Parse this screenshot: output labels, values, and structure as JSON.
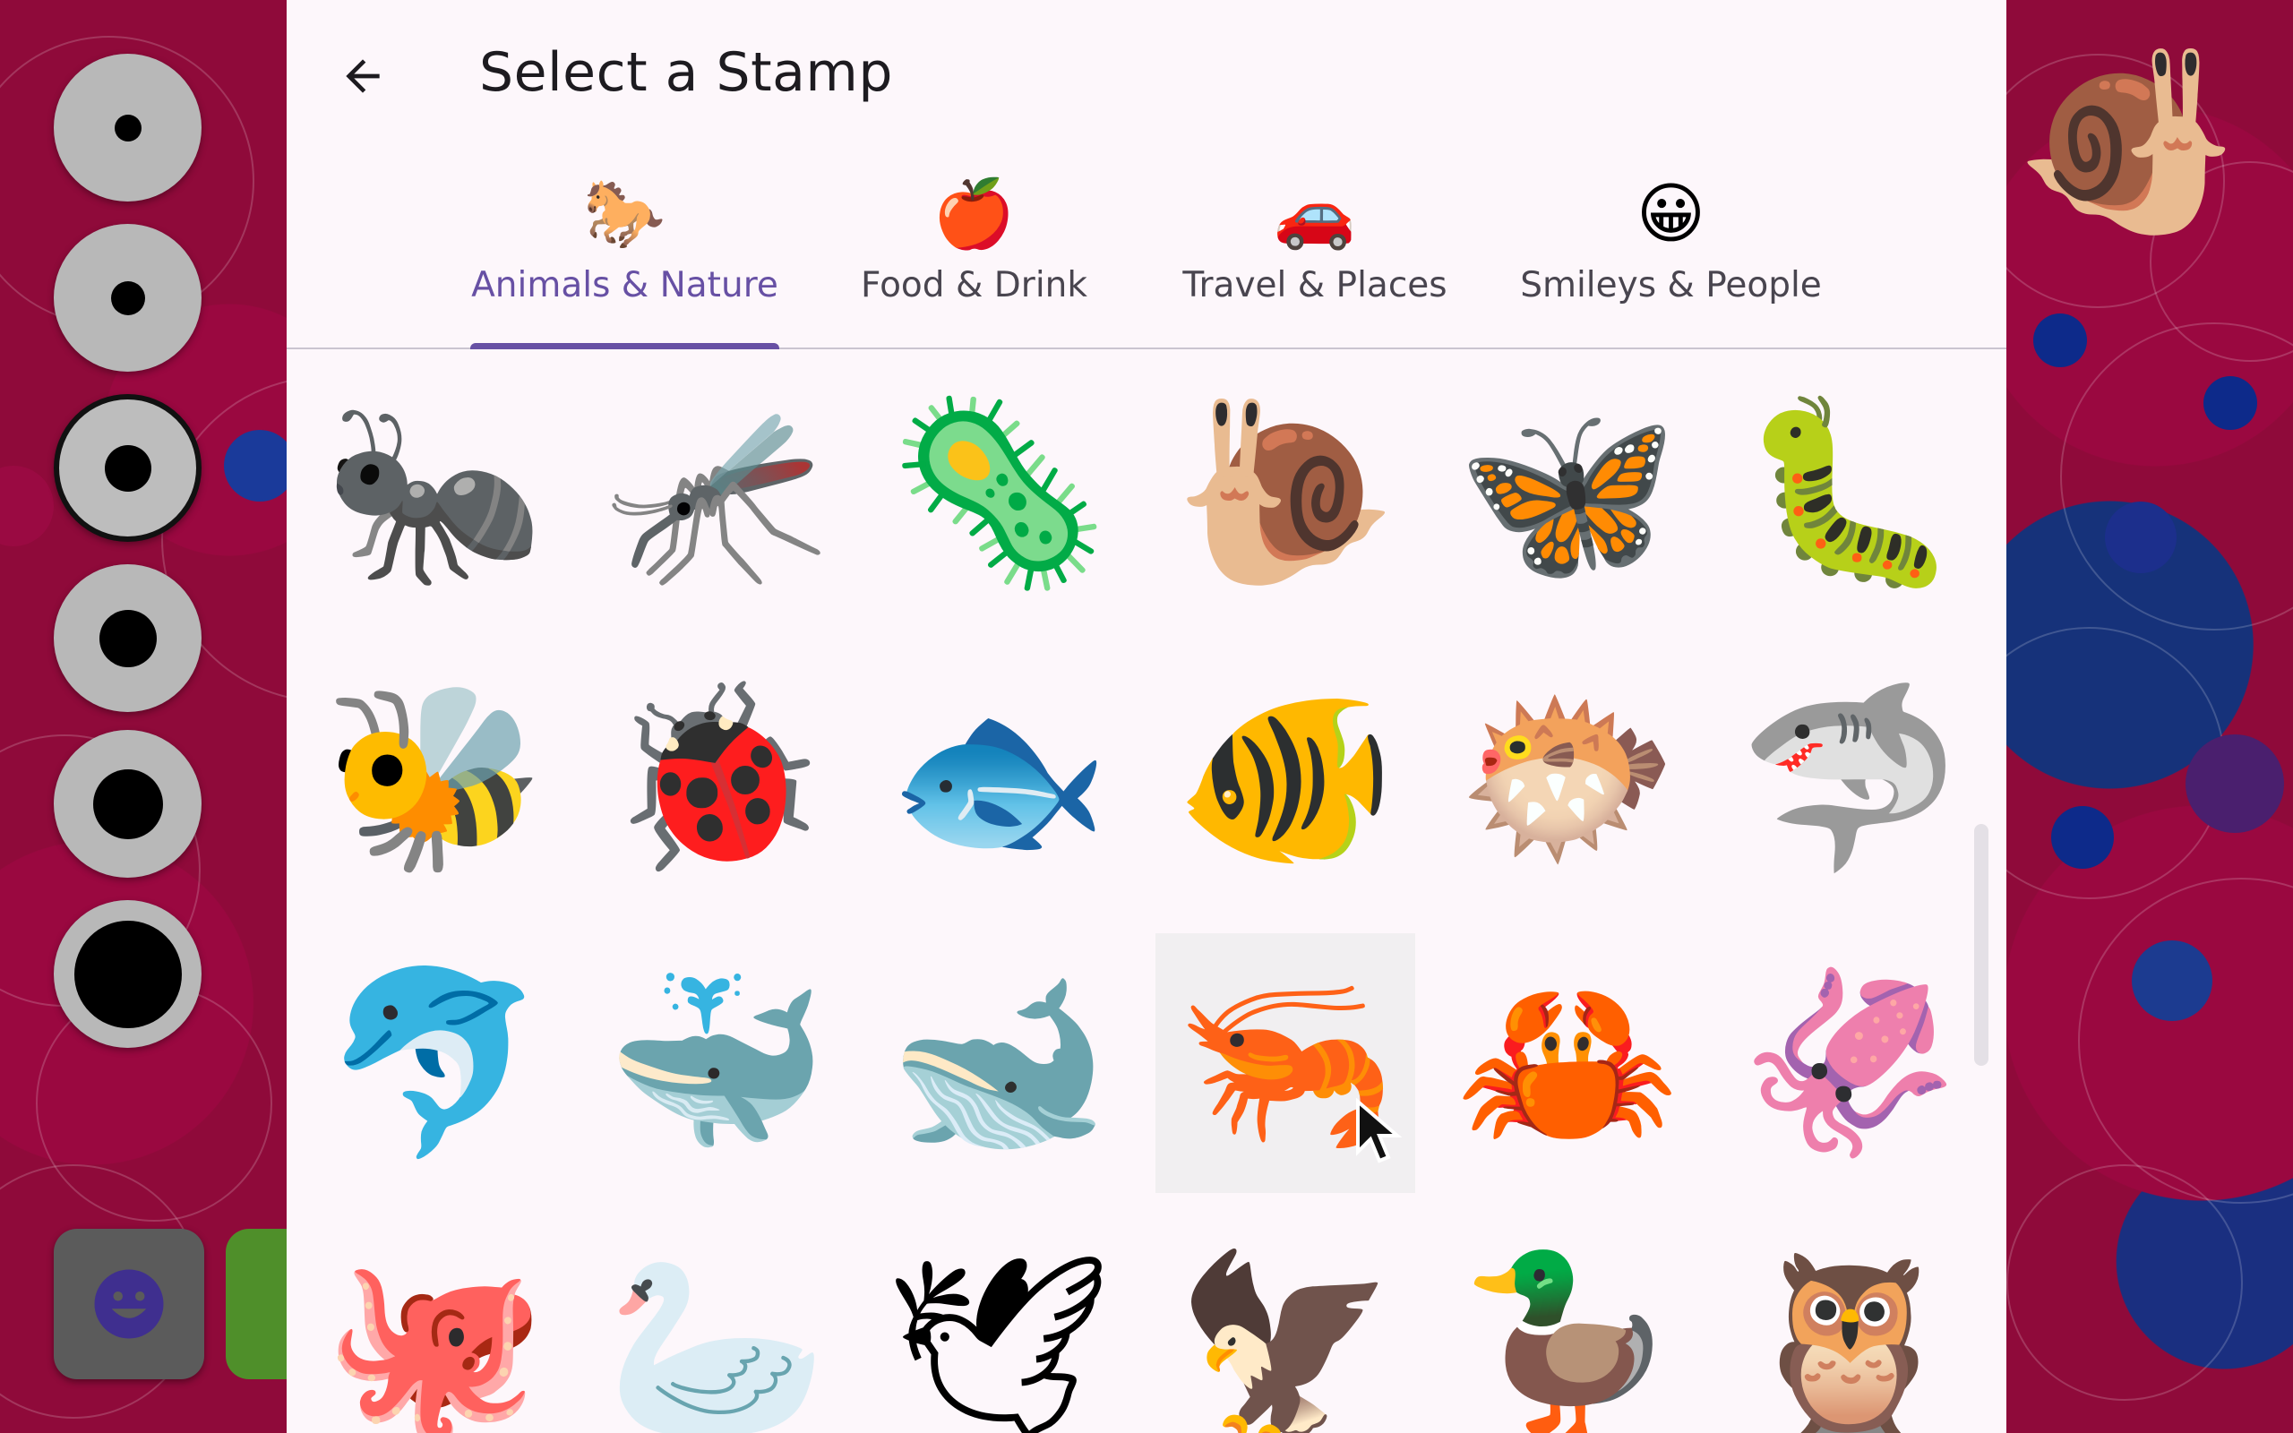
{
  "header": {
    "title": "Select a Stamp",
    "back_icon": "arrow-back-icon"
  },
  "tabs": [
    {
      "icon": "🐎",
      "label": "Animals & Nature",
      "active": true
    },
    {
      "icon": "🍎",
      "label": "Food & Drink",
      "active": false
    },
    {
      "icon": "🚗",
      "label": "Travel & Places",
      "active": false
    },
    {
      "icon": "😀",
      "label": "Smileys & People",
      "active": false
    }
  ],
  "stamps": [
    {
      "name": "ant",
      "glyph": "🐜"
    },
    {
      "name": "mosquito",
      "glyph": "🦟"
    },
    {
      "name": "microbe",
      "glyph": "🦠"
    },
    {
      "name": "snail",
      "glyph": "🐌"
    },
    {
      "name": "butterfly",
      "glyph": "🦋"
    },
    {
      "name": "bug",
      "glyph": "🐛"
    },
    {
      "name": "honeybee",
      "glyph": "🐝"
    },
    {
      "name": "lady-beetle",
      "glyph": "🐞"
    },
    {
      "name": "fish",
      "glyph": "🐟"
    },
    {
      "name": "tropical-fish",
      "glyph": "🐠"
    },
    {
      "name": "blowfish",
      "glyph": "🐡"
    },
    {
      "name": "shark",
      "glyph": "🦈"
    },
    {
      "name": "dolphin",
      "glyph": "🐬"
    },
    {
      "name": "spouting-whale",
      "glyph": "🐳"
    },
    {
      "name": "whale",
      "glyph": "🐋"
    },
    {
      "name": "shrimp",
      "glyph": "🦐"
    },
    {
      "name": "crab",
      "glyph": "🦀"
    },
    {
      "name": "squid",
      "glyph": "🦑"
    },
    {
      "name": "octopus",
      "glyph": "🐙"
    },
    {
      "name": "swan",
      "glyph": "🦢"
    },
    {
      "name": "dove",
      "glyph": "🕊"
    },
    {
      "name": "eagle",
      "glyph": "🦅"
    },
    {
      "name": "duck",
      "glyph": "🦆"
    },
    {
      "name": "owl",
      "glyph": "🦉"
    }
  ],
  "hovered_stamp": "shrimp",
  "tool_rail": {
    "brush_sizes": [
      "brush-size-1",
      "brush-size-2",
      "brush-size-3",
      "brush-size-4",
      "brush-size-5",
      "brush-size-6"
    ],
    "selected_brush": "brush-size-3",
    "stamp_tool_icon": "smiley-icon"
  },
  "colors": {
    "accent": "#6750a4",
    "dialog_bg": "#fdf7fb",
    "canvas_red": "#8f0a3a",
    "canvas_blue": "#16327a"
  }
}
